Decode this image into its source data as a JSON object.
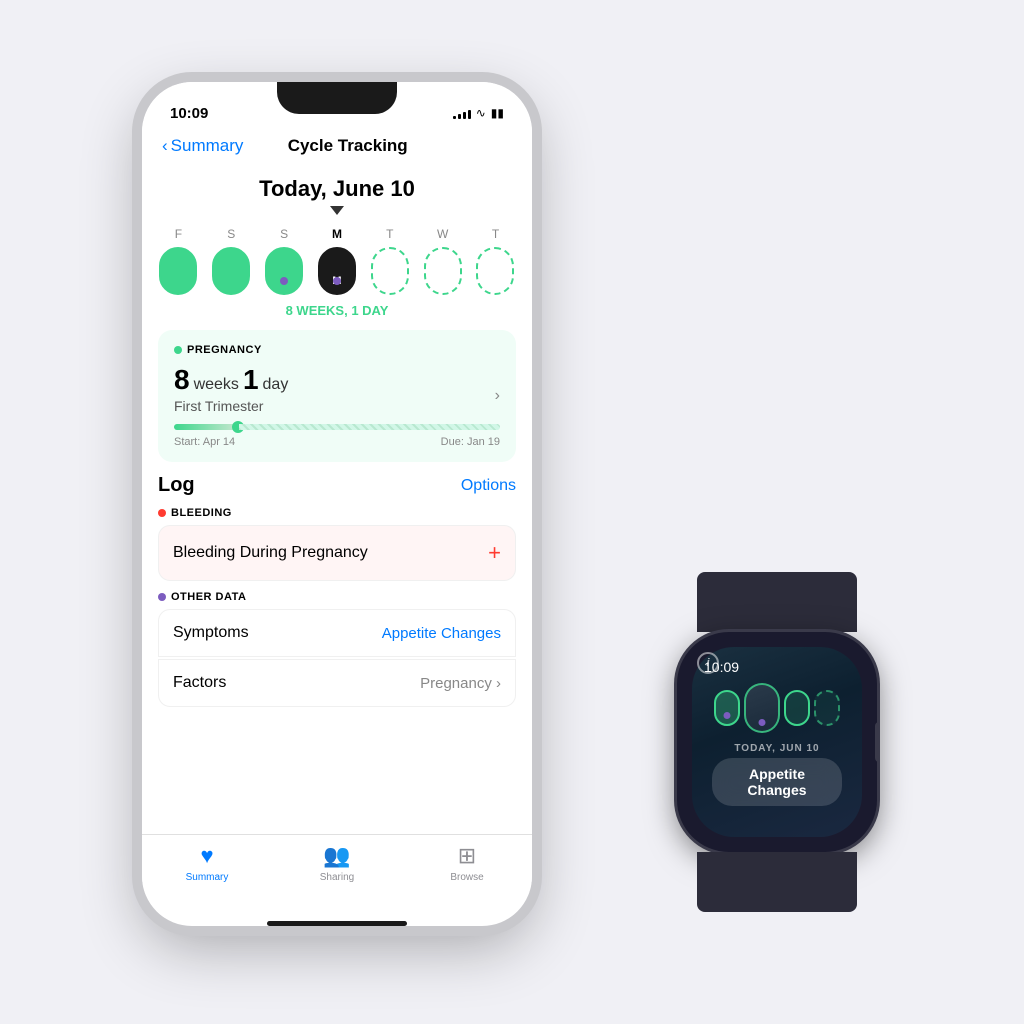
{
  "iphone": {
    "status": {
      "time": "10:09",
      "signal": [
        3,
        5,
        7,
        9,
        11
      ],
      "wifi": "wifi",
      "battery": "battery"
    },
    "nav": {
      "back_label": "Summary",
      "title": "Cycle Tracking"
    },
    "date_header": "Today, June 10",
    "calendar": {
      "weeks_label": "8 WEEKS, 1 DAY",
      "days": [
        "F",
        "S",
        "S",
        "M",
        "T",
        "W",
        "T"
      ],
      "active_day": "M"
    },
    "pregnancy": {
      "section_label": "PREGNANCY",
      "weeks_num": "8",
      "weeks_unit": "weeks",
      "days_num": "1",
      "days_unit": "day",
      "trimester": "First Trimester",
      "start": "Start: Apr 14",
      "due": "Due: Jan 19",
      "progress_pct": 20
    },
    "log": {
      "title": "Log",
      "options_label": "Options",
      "bleeding_label": "BLEEDING",
      "bleeding_row": "Bleeding During Pregnancy",
      "other_data_label": "OTHER DATA",
      "symptoms_label": "Symptoms",
      "symptoms_value": "Appetite Changes",
      "factors_label": "Factors",
      "factors_value": "Pregnancy"
    },
    "tab_bar": {
      "tabs": [
        {
          "label": "Summary",
          "icon": "♥",
          "active": true
        },
        {
          "label": "Sharing",
          "icon": "👥",
          "active": false
        },
        {
          "label": "Browse",
          "icon": "⊞",
          "active": false
        }
      ]
    }
  },
  "watch": {
    "time": "10:09",
    "date_label": "TODAY, JUN 10",
    "pill_text": "Appetite Changes"
  }
}
